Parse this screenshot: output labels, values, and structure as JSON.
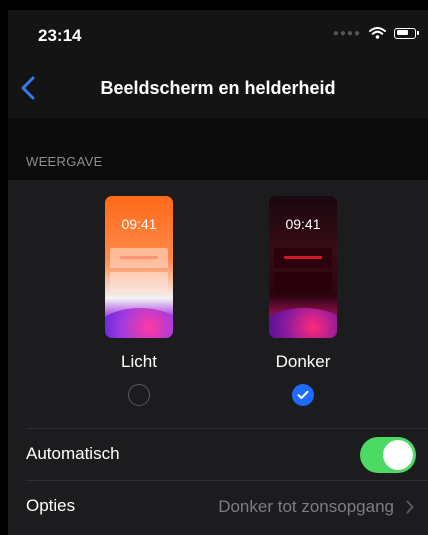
{
  "status_bar": {
    "time": "23:14"
  },
  "nav": {
    "title": "Beeldscherm en helderheid"
  },
  "appearance": {
    "section_header": "WEERGAVE",
    "options": [
      {
        "label": "Licht",
        "preview_time": "09:41",
        "selected": false
      },
      {
        "label": "Donker",
        "preview_time": "09:41",
        "selected": true
      }
    ]
  },
  "automatic": {
    "label": "Automatisch",
    "enabled": true
  },
  "options_row": {
    "label": "Opties",
    "value": "Donker tot zonsopgang"
  },
  "colors": {
    "accent": "#1e6bff",
    "toggle_on": "#4cd964",
    "background": "#1c1c1e",
    "back_chevron": "#2f7cf6"
  },
  "icons": [
    "back-chevron-icon",
    "wifi-icon",
    "battery-icon",
    "checkmark-icon",
    "chevron-right-icon"
  ]
}
